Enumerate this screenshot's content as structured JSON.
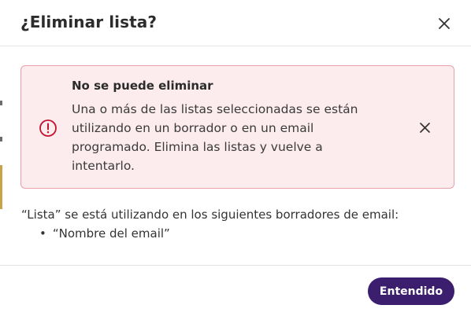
{
  "dialog": {
    "title": "¿Eliminar lista?"
  },
  "alert": {
    "title": "No se puede eliminar",
    "message_lines": [
      "Una o más de las listas seleccionadas se están",
      "utilizando en un borrador o en un email",
      "programado. Elimina las listas y vuelve a",
      "intentarlo."
    ],
    "icon": "alert-circle-icon"
  },
  "body": {
    "text": "“Lista” se está utilizando en los siguientes borradores de email:",
    "items": [
      "“Nombre del email”"
    ]
  },
  "footer": {
    "confirm_label": "Entendido"
  },
  "colors": {
    "primary": "#3b1f6e",
    "alert_bg": "#fdecee",
    "alert_border": "#e7a0aa",
    "alert_icon": "#c4122f"
  }
}
